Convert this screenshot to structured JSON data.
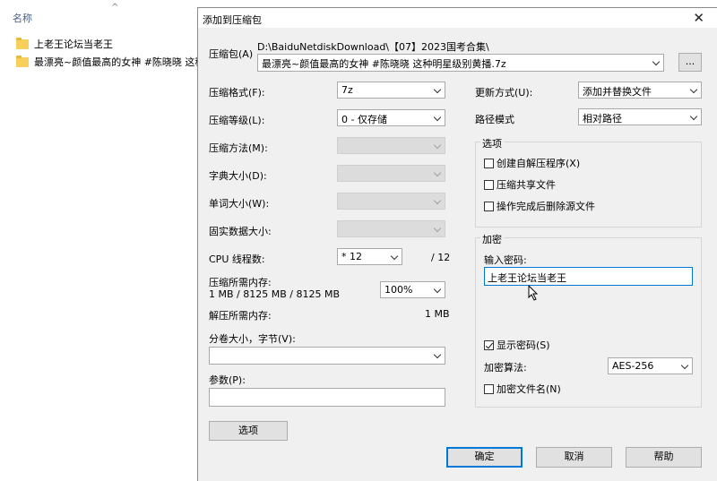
{
  "explorer": {
    "column_name": "名称",
    "files": [
      "上老王论坛当老王",
      "最漂亮~颜值最高的女神 #陈晓晓 这种"
    ]
  },
  "dialog": {
    "title": "添加到压缩包",
    "archive_label": "压缩包(A)",
    "archive_dir": "D:\\BaiduNetdiskDownload\\【07】2023国考合集\\",
    "archive_name": "最漂亮~颜值最高的女神 #陈晓晓 这种明星级别黄播.7z",
    "browse_label": "...",
    "format_label": "压缩格式(F):",
    "format_value": "7z",
    "level_label": "压缩等级(L):",
    "level_value": "0 - 仅存储",
    "method_label": "压缩方法(M):",
    "dict_label": "字典大小(D):",
    "word_label": "单词大小(W):",
    "solid_label": "固实数据大小:",
    "cpu_label": "CPU 线程数:",
    "cpu_value": "* 12",
    "cpu_max": "/ 12",
    "mem_label": "压缩所需内存:",
    "mem_value": "1 MB / 8125 MB / 8125 MB",
    "mem_percent": "100%",
    "decomp_label": "解压所需内存:",
    "decomp_value": "1 MB",
    "split_label": "分卷大小，字节(V):",
    "split_value": "",
    "params_label": "参数(P):",
    "params_value": "",
    "options_btn": "选项",
    "update_label": "更新方式(U):",
    "update_value": "添加并替换文件",
    "path_label": "路径模式",
    "path_value": "相对路径",
    "options_group": "选项",
    "opt_sfx": "创建自解压程序(X)",
    "opt_shared": "压缩共享文件",
    "opt_delete": "操作完成后删除源文件",
    "enc_group": "加密",
    "enc_pw_label": "输入密码:",
    "enc_pw_value": "上老王论坛当老王",
    "show_pw": "显示密码(S)",
    "algo_label": "加密算法:",
    "algo_value": "AES-256",
    "enc_names": "加密文件名(N)",
    "ok": "确定",
    "cancel": "取消",
    "help": "帮助"
  }
}
